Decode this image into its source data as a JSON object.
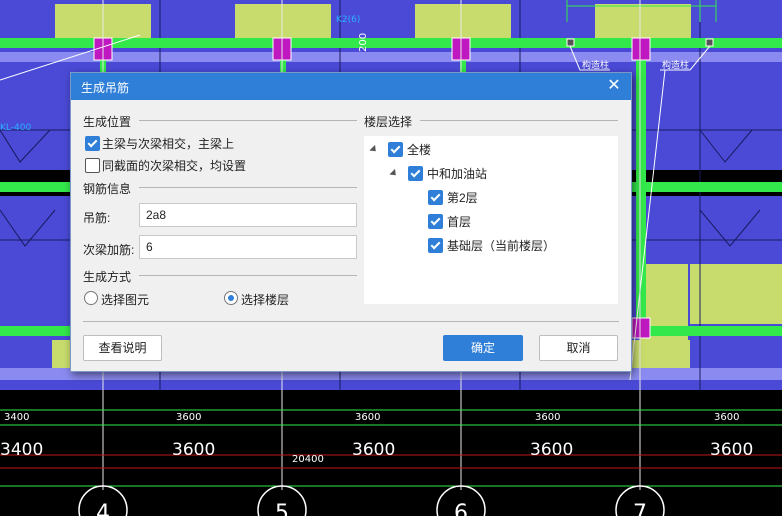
{
  "dialog": {
    "title": "生成吊筋",
    "close_glyph": "✕",
    "position_section": {
      "title": "生成位置",
      "options": [
        {
          "label": "主梁与次梁相交，主梁上",
          "checked": true
        },
        {
          "label": "同截面的次梁相交，均设置",
          "checked": false
        }
      ]
    },
    "rebar_section": {
      "title": "钢筋信息",
      "hanger_label": "吊筋:",
      "hanger_value": "2a8",
      "extra_label": "次梁加筋:",
      "extra_value": "6"
    },
    "method_section": {
      "title": "生成方式",
      "options": [
        {
          "label": "选择图元",
          "selected": false
        },
        {
          "label": "选择楼层",
          "selected": true
        }
      ]
    },
    "floor_section": {
      "title": "楼层选择",
      "tree": {
        "root": {
          "label": "全楼",
          "checked": true
        },
        "building": {
          "label": "中和加油站",
          "checked": true
        },
        "floors": [
          {
            "label": "第2层",
            "checked": true
          },
          {
            "label": "首层",
            "checked": true
          },
          {
            "label": "基础层（当前楼层）",
            "checked": true
          }
        ]
      }
    },
    "buttons": {
      "help": "查看说明",
      "ok": "确定",
      "cancel": "取消"
    }
  },
  "canvas": {
    "dim_labels_small": [
      "3400",
      "3600",
      "3600",
      "3600",
      "3600"
    ],
    "dim_labels_large": [
      "3400",
      "3600",
      "3600",
      "3600",
      "3600"
    ],
    "total_dim": "20400",
    "axis_labels": [
      "4",
      "5",
      "6",
      "7"
    ],
    "beam_dim_text": "200",
    "column_tags": [
      "构造柱",
      "构造柱"
    ],
    "misc_text": [
      "K2(6)",
      "KL-400",
      "200"
    ]
  },
  "colors": {
    "slab_blue": "#4a4ad6",
    "slab_yellow": "#c8dc6e",
    "beam_green": "#33e84a",
    "column_magenta": "#c018c0",
    "title_blue": "#2f7fd8"
  }
}
